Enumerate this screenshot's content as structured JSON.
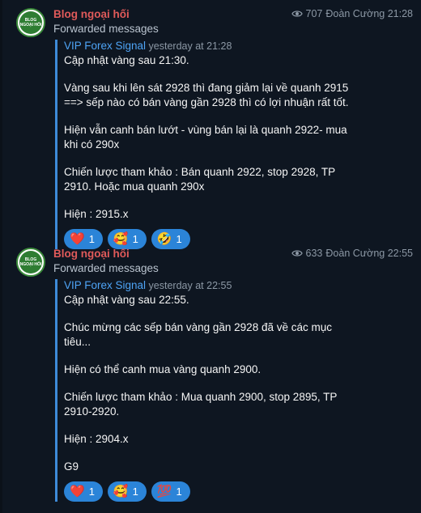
{
  "messages": [
    {
      "avatar_text": [
        "BLOG",
        "NGOẠI HỐI"
      ],
      "sender": "Blog ngoại hối",
      "forwarded": "Forwarded messages",
      "views": "707",
      "author_time": "Đoàn Cường 21:28",
      "channel": "VIP Forex Signal",
      "channel_time": "yesterday at 21:28",
      "lines": [
        "Cập nhật vàng sau 21:30.",
        "",
        "Vàng sau khi lên sát 2928 thì đang giảm lại về quanh 2915",
        "==> sếp nào có bán vàng gần 2928 thì có lợi nhuận rất tốt.",
        "",
        "Hiện vẫn canh bán lướt - vùng bán lại là quanh 2922- mua",
        "khi có 290x",
        "",
        "Chiến lược tham khảo : Bán quanh 2922, stop 2928, TP",
        "2910. Hoặc mua quanh 290x",
        "",
        "Hiện : 2915.x"
      ],
      "reactions": [
        {
          "emoji": "❤️",
          "count": "1",
          "icon": "heart-icon"
        },
        {
          "emoji": "🥰",
          "count": "1",
          "icon": "smiling-face-hearts-icon"
        },
        {
          "emoji": "🤣",
          "count": "1",
          "icon": "rofl-icon"
        }
      ]
    },
    {
      "avatar_text": [
        "BLOG",
        "NGOẠI HỐI"
      ],
      "sender": "Blog ngoại hối",
      "forwarded": "Forwarded messages",
      "views": "633",
      "author_time": "Đoàn Cường 22:55",
      "channel": "VIP Forex Signal",
      "channel_time": "yesterday at 22:55",
      "lines": [
        "Cập nhật vàng sau 22:55.",
        "",
        "Chúc mừng các sếp bán vàng gần 2928 đã về các mục",
        "tiêu...",
        "",
        "Hiện có thể canh mua vàng quanh 2900.",
        "",
        "Chiến lược tham khảo : Mua quanh 2900, stop 2895, TP",
        "2910-2920.",
        "",
        "Hiện : 2904.x",
        "",
        "G9"
      ],
      "reactions": [
        {
          "emoji": "❤️",
          "count": "1",
          "icon": "heart-icon"
        },
        {
          "emoji": "🥰",
          "count": "1",
          "icon": "smiling-face-hearts-icon"
        },
        {
          "emoji": "💯",
          "count": "1",
          "icon": "hundred-points-icon"
        }
      ]
    }
  ]
}
